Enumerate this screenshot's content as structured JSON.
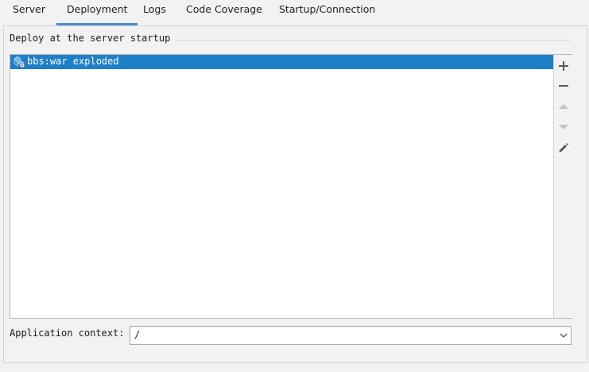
{
  "tabs": [
    {
      "label": "Server",
      "active": false
    },
    {
      "label": "Deployment",
      "active": true
    },
    {
      "label": "Logs",
      "active": false
    },
    {
      "label": "Code Coverage",
      "active": false
    },
    {
      "label": "Startup/Connection",
      "active": false
    }
  ],
  "deploy_group": {
    "title": "Deploy at the server startup",
    "items": [
      {
        "label": "bbs:war exploded",
        "icon": "artifact-icon",
        "selected": true
      }
    ]
  },
  "toolbar": {
    "add_icon": "plus-icon",
    "remove_icon": "minus-icon",
    "move_up_icon": "arrow-up-icon",
    "move_down_icon": "arrow-down-icon",
    "edit_icon": "pencil-icon"
  },
  "app_context": {
    "label": "Application context:",
    "value": "/"
  },
  "colors": {
    "accent": "#4a8bd4",
    "selection": "#1e7fc9",
    "background": "#f2f2f2"
  }
}
